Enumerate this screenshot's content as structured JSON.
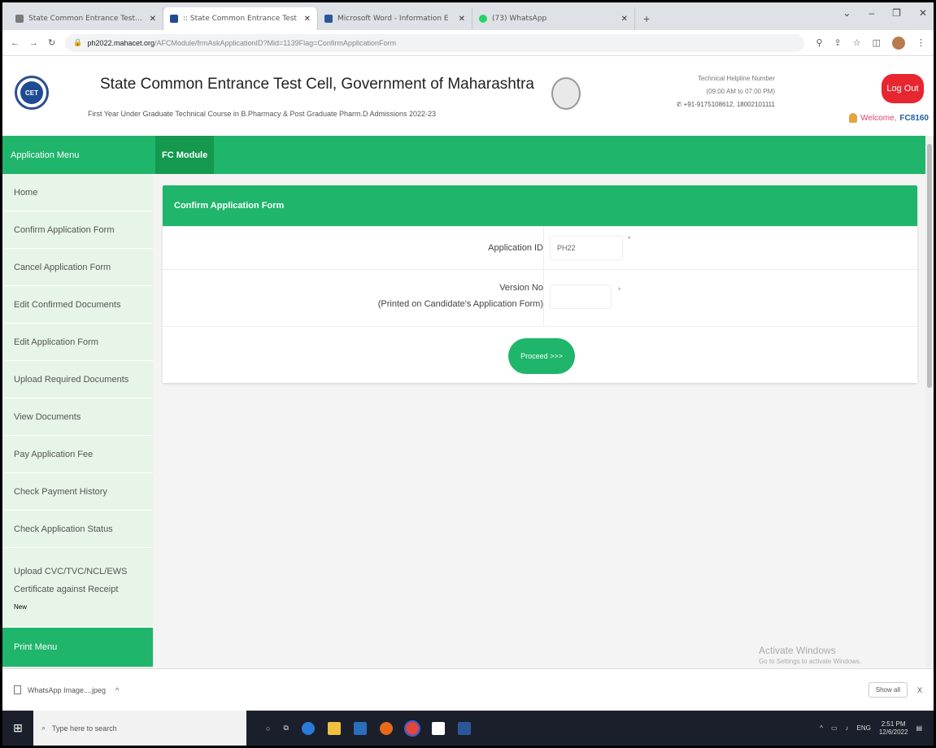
{
  "browser": {
    "tabs": [
      {
        "label": "State Common Entrance Test Ce",
        "color": "#7b7b7b"
      },
      {
        "label": ":: State Common Entrance Test",
        "color": "#1f4b93"
      },
      {
        "label": "Microsoft Word - Information E",
        "color": "#2b579a"
      },
      {
        "label": "(73) WhatsApp",
        "color": "#25d366"
      }
    ],
    "new_tab": "+",
    "url_host": "ph2022.mahacet.org",
    "url_path": "/AFCModule/frmAskApplicationID?Mid=1139Flag=ConfirmApplicationForm"
  },
  "header": {
    "logo_text": "CET",
    "title": "State Common Entrance Test Cell, Government of Maharashtra",
    "subtitle": "First Year Under Graduate Technical Course in B.Pharmacy & Post Graduate Pharm.D Admissions 2022-23",
    "helpline_title": "Technical Helpline Number",
    "helpline_hours": "(09:00 AM to 07:00 PM)",
    "helpline_phones": "+91-9175108612, 18002101111",
    "logout_label": "Log Out",
    "welcome_label": "Welcome,",
    "welcome_user": "FC8160"
  },
  "nav": {
    "menu_title": "Application Menu",
    "module_tab": "FC Module"
  },
  "sidebar": {
    "items": [
      "Home",
      "Confirm Application Form",
      "Cancel Application Form",
      "Edit Confirmed Documents",
      "Edit Application Form",
      "Upload Required Documents",
      "View Documents",
      "Pay Application Fee",
      "Check Payment History",
      "Check Application Status"
    ],
    "upload_line1": "Upload CVC/TVC/NCL/EWS",
    "upload_line2": "Certificate against Receipt",
    "upload_line3": "New",
    "print_menu": "Print Menu"
  },
  "form": {
    "heading": "Confirm Application Form",
    "app_id_label": "Application ID",
    "app_id_value": "PH22",
    "version_label": "Version No",
    "version_sublabel": "(Printed on Candidate's Application Form)",
    "version_value": "",
    "required_mark": "*",
    "proceed_label": "Proceed >>>"
  },
  "watermark": {
    "line1": "Activate Windows",
    "line2": "Go to Settings to activate Windows."
  },
  "downloads": {
    "file": "WhatsApp Image....jpeg",
    "chevron": "^",
    "show_all": "Show all",
    "close": "X"
  },
  "taskbar": {
    "search_placeholder": "Type here to search",
    "lang": "ENG",
    "time": "2:51 PM",
    "date": "12/6/2022"
  },
  "colors": {
    "accent_green": "#1fb56b",
    "sidebar_bg": "#e6f5e8",
    "logout_red": "#e8262f"
  }
}
